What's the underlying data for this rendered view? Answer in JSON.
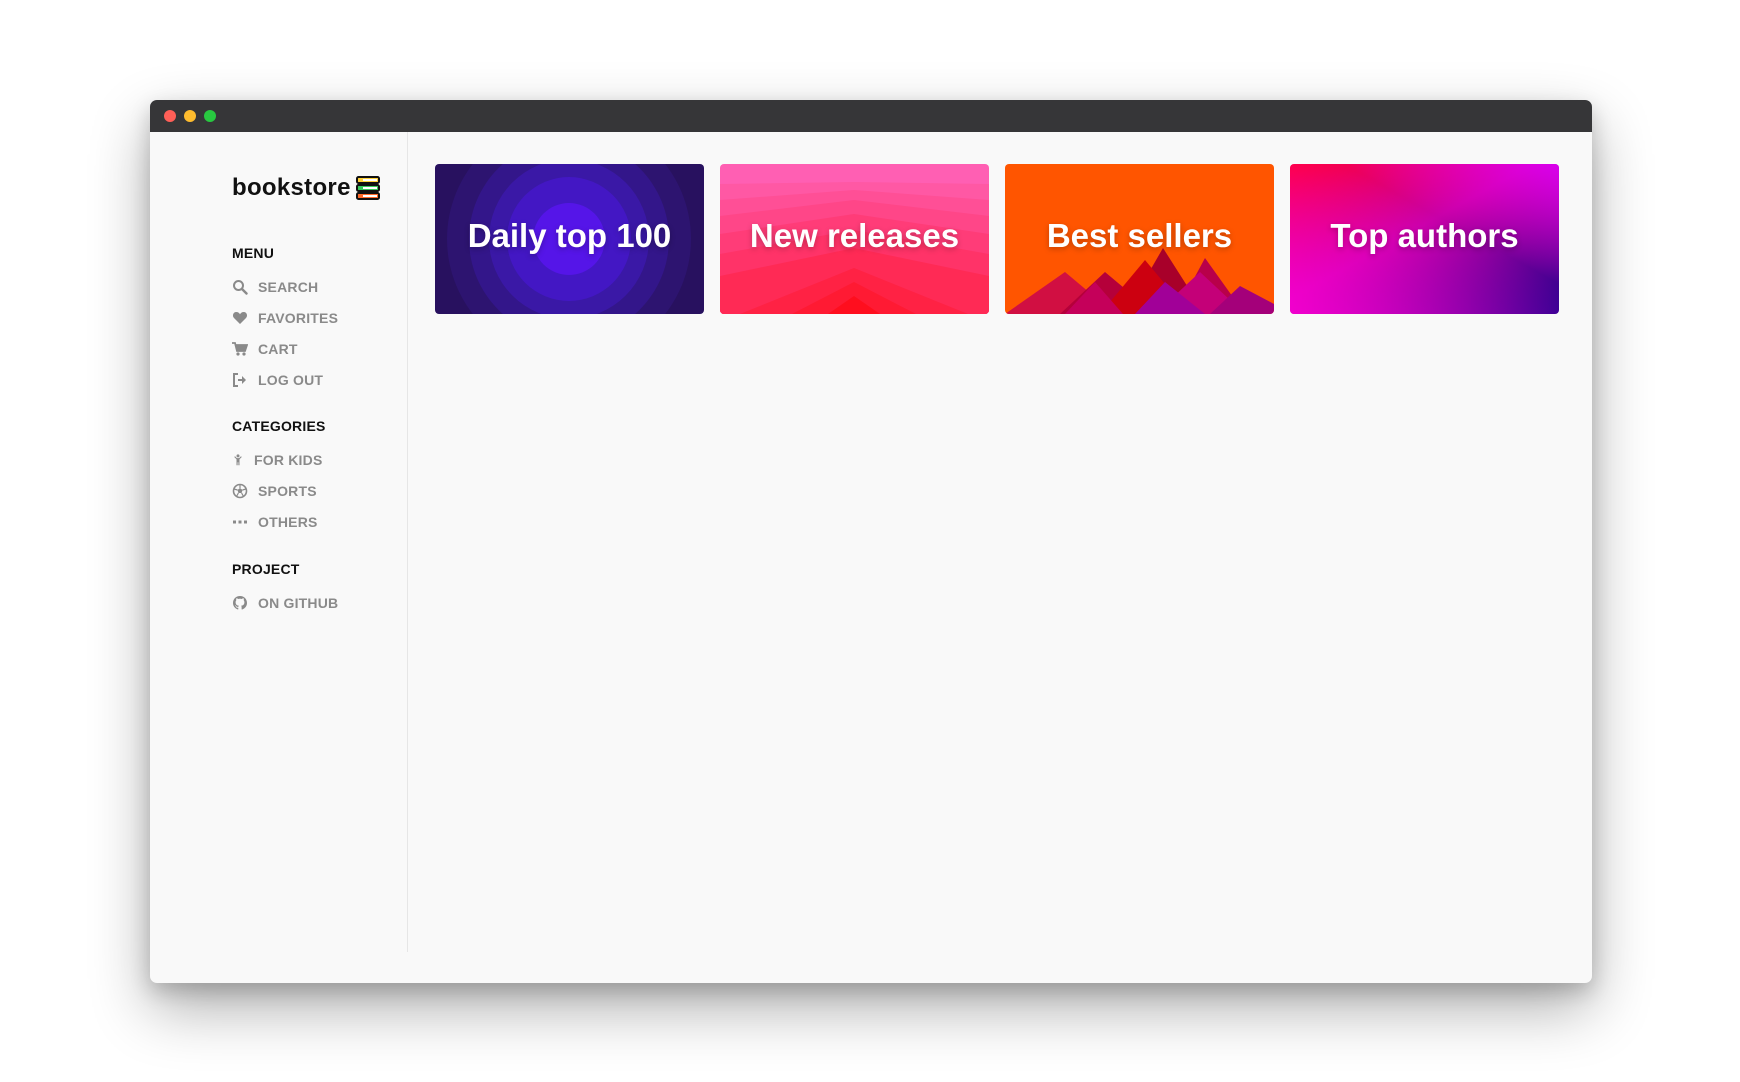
{
  "app": {
    "logo_text": "bookstore",
    "colors": {
      "red": "#ff5f57",
      "yellow": "#febc2e",
      "green": "#28c840"
    }
  },
  "sidebar": {
    "menu": {
      "title": "MENU",
      "items": [
        {
          "icon": "search-icon",
          "label": "SEARCH"
        },
        {
          "icon": "heart-icon",
          "label": "FAVORITES"
        },
        {
          "icon": "cart-icon",
          "label": "CART"
        },
        {
          "icon": "logout-icon",
          "label": "LOG OUT"
        }
      ]
    },
    "categories": {
      "title": "CATEGORIES",
      "items": [
        {
          "icon": "child-icon",
          "label": "FOR KIDS"
        },
        {
          "icon": "soccer-ball-icon",
          "label": "SPORTS"
        },
        {
          "icon": "ellipsis-icon",
          "label": "OTHERS"
        }
      ]
    },
    "project": {
      "title": "PROJECT",
      "items": [
        {
          "icon": "github-icon",
          "label": "ON GITHUB"
        }
      ]
    }
  },
  "cards": [
    {
      "label": "Daily top 100",
      "color": "#3a17b8"
    },
    {
      "label": "New releases",
      "color": "#ff3d7f"
    },
    {
      "label": "Best sellers",
      "color": "#ff5500"
    },
    {
      "label": "Top authors",
      "color": "#b000c8"
    }
  ]
}
